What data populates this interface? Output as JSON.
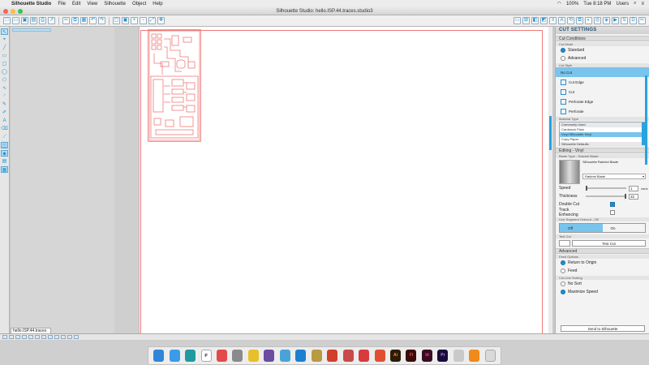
{
  "menubar": {
    "app_name": "Silhouette Studio",
    "menus": [
      "File",
      "Edit",
      "View",
      "Silhouette",
      "Object",
      "Help"
    ],
    "clock": "Tue 8:18 PM",
    "user": "Users",
    "battery": "100%"
  },
  "window": {
    "title": "Silhouette Studio: hello.ISP.44.traces.studio3"
  },
  "doc_tab": {
    "label": "hello.ISP.44.traces"
  },
  "panel": {
    "title": "CUT SETTINGS",
    "cut_conditions": "Cut Conditions",
    "cut_mode_label": "Cut Mode",
    "mode_standard": "Standard",
    "mode_advanced": "Advanced",
    "cut_style_label": "Cut Style",
    "styles": [
      "No Cut",
      "Cut Edge",
      "Cut",
      "Perforate Edge",
      "Perforate"
    ],
    "material_type_label": "Material Type",
    "materials": [
      "Commonly Used",
      "Cardstock Plain",
      "Vinyl Silhouette Vinyl",
      "Copy Paper",
      "Silhouette Defaults"
    ],
    "editing": "Editing - Vinyl",
    "blade_label": "Blade Type - Ratchet Blade",
    "blade_name": "Silhouette Ratchet Blade",
    "blade_select": "Ratchet Blade",
    "speed_label": "Speed",
    "speed_value": "1",
    "speed_unit": "cm/s",
    "thickness_label": "Thickness",
    "thickness_value": "32",
    "double_cut": "Double Cut",
    "track_enhancing": "Track Enhancing",
    "line_seg_label": "Line Segment Overcut - Off",
    "seg_off": "Off",
    "seg_on": "On",
    "test_cut_label": "Test Cut",
    "test_cut": "Test Cut",
    "advanced": "Advanced",
    "feed_options_label": "Feed Options",
    "return_origin": "Return to Origin",
    "feed": "Feed",
    "cut_line_label": "Cut Line Sorting",
    "no_sort": "No Sort",
    "max_speed": "Maximize Speed",
    "send": "Send to Silhouette"
  },
  "dock_icons": [
    "finder-icon",
    "safari-icon",
    "arduino-icon",
    "pinterest-icon",
    "app-icon",
    "app-icon",
    "app-icon",
    "app-icon",
    "app-icon",
    "app-icon",
    "app-icon",
    "app-icon",
    "app-icon",
    "app-icon",
    "app-icon",
    "illustrator-icon",
    "flash-icon",
    "indesign-icon",
    "premiere-icon",
    "app-icon",
    "vlc-icon",
    "trash-icon"
  ],
  "colors": {
    "accent": "#28a3e0",
    "trace": "#f07a7a",
    "selection": "#79c4ec"
  }
}
